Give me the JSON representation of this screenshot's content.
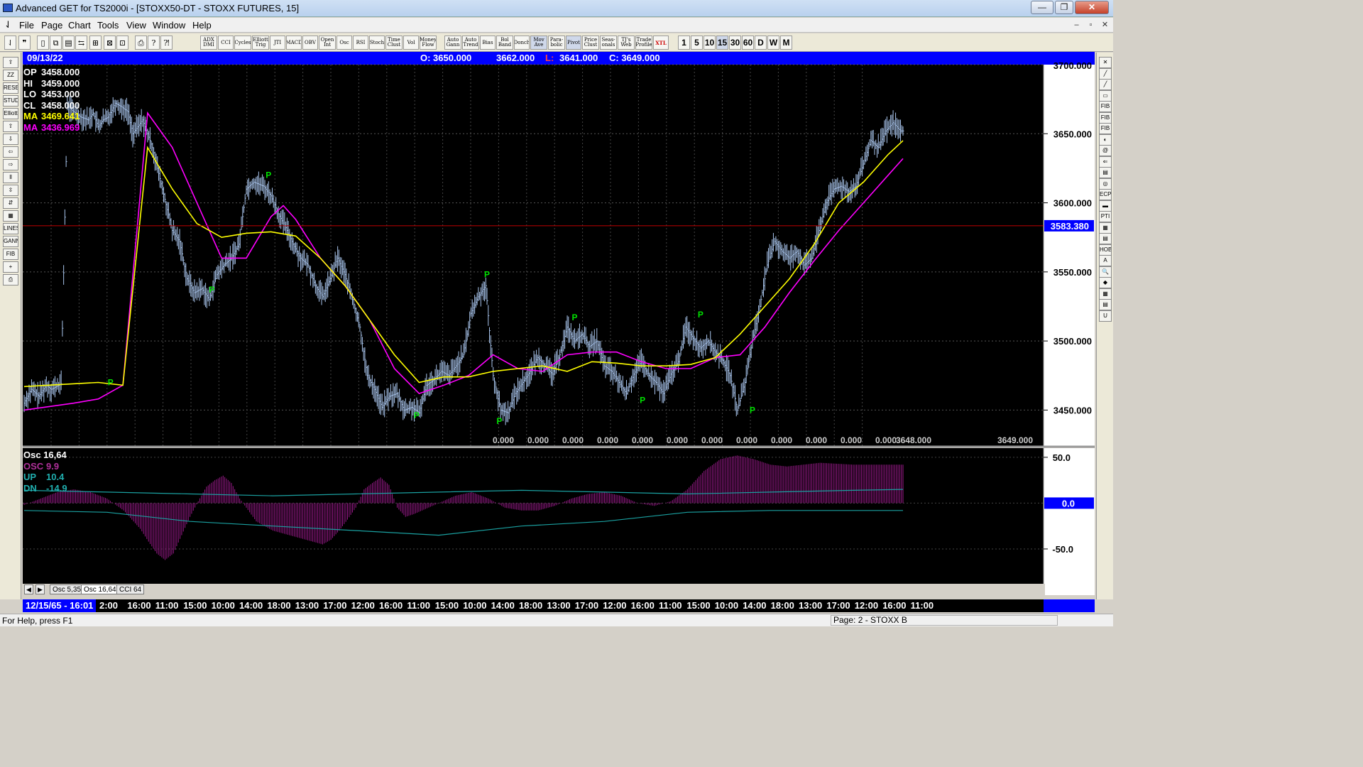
{
  "window": {
    "title": "Advanced GET for TS2000i - [STOXX50-DT - STOXX FUTURES, 15]",
    "buttons": {
      "minimize": "—",
      "maximize": "❐",
      "close": "✕"
    }
  },
  "menu": {
    "items": [
      "File",
      "Page",
      "Chart",
      "Tools",
      "View",
      "Window",
      "Help"
    ],
    "mdi_buttons": [
      "–",
      "▫",
      "✕"
    ]
  },
  "toolbar": {
    "study_buttons": [
      "ADX DMI",
      "CCI",
      "Cycles",
      "Elliott Trig",
      "JTI",
      "MACD",
      "OBV",
      "Open Int",
      "Osc",
      "RSI",
      "Stoch",
      "Time Clust",
      "Vol",
      "Money Flow",
      "Auto Gann",
      "Auto Trend",
      "Bias",
      "Bol Band",
      "Donch",
      "Mov Ave",
      "Para-bolic",
      "Pivot",
      "Price Clust",
      "Seas-onals",
      "TJ's Web",
      "Trade Profile",
      "XTL"
    ],
    "timeframes": [
      "1",
      "5",
      "10",
      "15",
      "30",
      "60",
      "D",
      "W",
      "M"
    ],
    "active_timeframe": "15"
  },
  "left_tools": [
    "⇪",
    "ZZ",
    "RESET",
    "STUDY",
    "Elliott",
    "⇧",
    "⇩",
    "⇦",
    "⇨",
    "⫴",
    "⇳",
    "⇵",
    "▦",
    "LINES",
    "GANN",
    "FIB",
    "+",
    "⎙"
  ],
  "right_tools": [
    "✕",
    "╱",
    "╱",
    "▭",
    "FIB RET",
    "FIB EXT",
    "FIB TIME",
    "◐",
    "@",
    "⇐",
    "▤",
    "◎",
    "ECPS",
    "▬",
    "PTI",
    "▦",
    "▤",
    "HOB",
    "A",
    "🔍",
    "◆",
    "▦",
    "▤",
    "U"
  ],
  "infobar": {
    "date": "09/13/22",
    "open": "O: 3650.000",
    "high": "3662.000",
    "low_label": "L:",
    "low_value": "3641.000",
    "close": "C: 3649.000"
  },
  "legend": [
    {
      "label": "OP",
      "value": "3458.000",
      "color": "#ffffff"
    },
    {
      "label": "HI",
      "value": "3459.000",
      "color": "#ffffff"
    },
    {
      "label": "LO",
      "value": "3453.000",
      "color": "#ffffff"
    },
    {
      "label": "CL",
      "value": "3458.000",
      "color": "#ffffff"
    },
    {
      "label": "MA",
      "value": "3469.641",
      "color": "#ffff00"
    },
    {
      "label": "MA",
      "value": "3436.969",
      "color": "#ff00ff"
    }
  ],
  "price_axis": {
    "ticks": [
      "3700.000",
      "3650.000",
      "3600.000",
      "3550.000",
      "3500.000",
      "3450.000"
    ],
    "marker": "3583.380",
    "bottom_values": [
      "0.000",
      "0.000",
      "0.000",
      "0.000",
      "0.000",
      "0.000",
      "0.000",
      "0.000",
      "0.000",
      "0.000",
      "0.000",
      "0.000",
      "3648.000",
      "3649.000"
    ]
  },
  "oscillator": {
    "title": "Osc 16,64",
    "legend": [
      {
        "label": "OSC",
        "value": "9.9",
        "color": "#b0309a"
      },
      {
        "label": "UP",
        "value": "10.4",
        "color": "#20b0b0"
      },
      {
        "label": "DN",
        "value": "-14.9",
        "color": "#20b0b0"
      }
    ],
    "ticks": [
      "50.0",
      "-50.0"
    ],
    "marker": "0.0",
    "tabs": [
      "Osc 5,35",
      "Osc 16,64",
      "CCI 64"
    ],
    "active_tab": "Osc 16,64",
    "nav": [
      "◀",
      "▶"
    ]
  },
  "time_axis": {
    "start": "12/15/65 - 16:01",
    "labels": [
      "2:00",
      "16:00",
      "11:00",
      "15:00",
      "10:00",
      "14:00",
      "18:00",
      "13:00",
      "17:00",
      "12:00",
      "16:00",
      "11:00",
      "15:00",
      "10:00",
      "14:00",
      "18:00",
      "13:00",
      "17:00",
      "12:00",
      "16:00",
      "11:00",
      "15:00",
      "10:00",
      "14:00",
      "18:00",
      "13:00",
      "17:00",
      "12:00",
      "16:00",
      "11:00"
    ]
  },
  "status": {
    "help": "For Help, press F1",
    "page": "Page: 2 - STOXX B"
  },
  "colors": {
    "chart_bg": "#000000",
    "bar": "#aac6ee",
    "ma_fast": "#ffff00",
    "ma_slow": "#ff00ff",
    "pivot": "#00e000",
    "osc": "#9a1a8a",
    "osc_band": "#1aa0a0",
    "info_blue": "#0000ff",
    "hline": "#c00000"
  },
  "chart_data": {
    "type": "line",
    "title": "STOXX50-DT - STOXX FUTURES, 15",
    "ylim": [
      3425,
      3700
    ],
    "close_path": [
      [
        0,
        3455
      ],
      [
        6,
        3465
      ],
      [
        12,
        3460
      ],
      [
        18,
        3468
      ],
      [
        22,
        3465
      ],
      [
        30,
        3469
      ],
      [
        35,
        3670
      ],
      [
        40,
        3666
      ],
      [
        46,
        3662
      ],
      [
        52,
        3660
      ],
      [
        56,
        3665
      ],
      [
        60,
        3655
      ],
      [
        64,
        3660
      ],
      [
        68,
        3662
      ],
      [
        74,
        3672
      ],
      [
        78,
        3670
      ],
      [
        84,
        3666
      ],
      [
        88,
        3650
      ],
      [
        96,
        3660
      ],
      [
        104,
        3640
      ],
      [
        112,
        3610
      ],
      [
        120,
        3580
      ],
      [
        126,
        3572
      ],
      [
        132,
        3545
      ],
      [
        138,
        3535
      ],
      [
        144,
        3538
      ],
      [
        150,
        3530
      ],
      [
        156,
        3548
      ],
      [
        162,
        3555
      ],
      [
        168,
        3560
      ],
      [
        174,
        3570
      ],
      [
        180,
        3610
      ],
      [
        186,
        3615
      ],
      [
        194,
        3612
      ],
      [
        200,
        3605
      ],
      [
        206,
        3592
      ],
      [
        212,
        3582
      ],
      [
        218,
        3570
      ],
      [
        224,
        3560
      ],
      [
        230,
        3555
      ],
      [
        236,
        3540
      ],
      [
        242,
        3532
      ],
      [
        248,
        3545
      ],
      [
        254,
        3560
      ],
      [
        260,
        3548
      ],
      [
        266,
        3530
      ],
      [
        272,
        3510
      ],
      [
        278,
        3475
      ],
      [
        284,
        3465
      ],
      [
        290,
        3452
      ],
      [
        296,
        3460
      ],
      [
        302,
        3462
      ],
      [
        308,
        3450
      ],
      [
        314,
        3452
      ],
      [
        320,
        3448
      ],
      [
        326,
        3468
      ],
      [
        332,
        3472
      ],
      [
        338,
        3478
      ],
      [
        344,
        3475
      ],
      [
        350,
        3482
      ],
      [
        356,
        3490
      ],
      [
        362,
        3520
      ],
      [
        368,
        3532
      ],
      [
        374,
        3540
      ],
      [
        380,
        3475
      ],
      [
        386,
        3450
      ],
      [
        392,
        3448
      ],
      [
        398,
        3462
      ],
      [
        404,
        3470
      ],
      [
        410,
        3478
      ],
      [
        416,
        3488
      ],
      [
        422,
        3482
      ],
      [
        428,
        3476
      ],
      [
        434,
        3490
      ],
      [
        440,
        3510
      ],
      [
        446,
        3500
      ],
      [
        452,
        3505
      ],
      [
        458,
        3496
      ],
      [
        464,
        3500
      ],
      [
        470,
        3482
      ],
      [
        476,
        3478
      ],
      [
        482,
        3470
      ],
      [
        488,
        3462
      ],
      [
        494,
        3476
      ],
      [
        500,
        3485
      ],
      [
        506,
        3475
      ],
      [
        512,
        3470
      ],
      [
        518,
        3462
      ],
      [
        524,
        3476
      ],
      [
        530,
        3485
      ],
      [
        536,
        3510
      ],
      [
        542,
        3502
      ],
      [
        548,
        3495
      ],
      [
        554,
        3500
      ],
      [
        560,
        3492
      ],
      [
        566,
        3486
      ],
      [
        572,
        3475
      ],
      [
        578,
        3450
      ],
      [
        584,
        3470
      ],
      [
        590,
        3500
      ],
      [
        596,
        3525
      ],
      [
        602,
        3555
      ],
      [
        608,
        3572
      ],
      [
        614,
        3565
      ],
      [
        620,
        3560
      ],
      [
        626,
        3565
      ],
      [
        632,
        3555
      ],
      [
        638,
        3560
      ],
      [
        644,
        3580
      ],
      [
        650,
        3600
      ],
      [
        656,
        3610
      ],
      [
        662,
        3612
      ],
      [
        668,
        3608
      ],
      [
        674,
        3612
      ],
      [
        680,
        3628
      ],
      [
        686,
        3645
      ],
      [
        692,
        3640
      ],
      [
        698,
        3652
      ],
      [
        704,
        3658
      ],
      [
        710,
        3652
      ]
    ],
    "ma_fast": [
      [
        0,
        3467
      ],
      [
        60,
        3470
      ],
      [
        80,
        3468
      ],
      [
        100,
        3640
      ],
      [
        120,
        3610
      ],
      [
        140,
        3585
      ],
      [
        160,
        3575
      ],
      [
        180,
        3578
      ],
      [
        200,
        3579
      ],
      [
        220,
        3576
      ],
      [
        240,
        3560
      ],
      [
        260,
        3540
      ],
      [
        280,
        3515
      ],
      [
        300,
        3490
      ],
      [
        320,
        3470
      ],
      [
        340,
        3474
      ],
      [
        360,
        3474
      ],
      [
        380,
        3478
      ],
      [
        400,
        3480
      ],
      [
        420,
        3482
      ],
      [
        440,
        3478
      ],
      [
        460,
        3485
      ],
      [
        480,
        3484
      ],
      [
        500,
        3482
      ],
      [
        520,
        3482
      ],
      [
        540,
        3483
      ],
      [
        560,
        3488
      ],
      [
        580,
        3505
      ],
      [
        600,
        3525
      ],
      [
        620,
        3545
      ],
      [
        640,
        3570
      ],
      [
        660,
        3600
      ],
      [
        680,
        3615
      ],
      [
        700,
        3635
      ],
      [
        712,
        3645
      ]
    ],
    "ma_slow": [
      [
        0,
        3450
      ],
      [
        40,
        3455
      ],
      [
        60,
        3458
      ],
      [
        80,
        3468
      ],
      [
        100,
        3665
      ],
      [
        120,
        3640
      ],
      [
        140,
        3600
      ],
      [
        160,
        3560
      ],
      [
        180,
        3560
      ],
      [
        200,
        3590
      ],
      [
        210,
        3598
      ],
      [
        220,
        3588
      ],
      [
        240,
        3560
      ],
      [
        260,
        3540
      ],
      [
        280,
        3515
      ],
      [
        300,
        3480
      ],
      [
        320,
        3462
      ],
      [
        340,
        3468
      ],
      [
        360,
        3475
      ],
      [
        380,
        3490
      ],
      [
        400,
        3480
      ],
      [
        420,
        3478
      ],
      [
        440,
        3490
      ],
      [
        460,
        3492
      ],
      [
        480,
        3492
      ],
      [
        500,
        3485
      ],
      [
        520,
        3480
      ],
      [
        540,
        3480
      ],
      [
        560,
        3488
      ],
      [
        580,
        3490
      ],
      [
        600,
        3510
      ],
      [
        620,
        3535
      ],
      [
        640,
        3558
      ],
      [
        660,
        3580
      ],
      [
        680,
        3600
      ],
      [
        700,
        3620
      ],
      [
        712,
        3632
      ]
    ],
    "pivots": [
      {
        "x": 70,
        "y": 3468
      },
      {
        "x": 152,
        "y": 3535
      },
      {
        "x": 198,
        "y": 3618
      },
      {
        "x": 318,
        "y": 3444
      },
      {
        "x": 375,
        "y": 3546
      },
      {
        "x": 385,
        "y": 3440
      },
      {
        "x": 446,
        "y": 3515
      },
      {
        "x": 501,
        "y": 3455
      },
      {
        "x": 548,
        "y": 3517
      },
      {
        "x": 590,
        "y": 3448
      }
    ],
    "osc_values": [
      [
        0,
        -2
      ],
      [
        20,
        5
      ],
      [
        40,
        12
      ],
      [
        60,
        15
      ],
      [
        80,
        12
      ],
      [
        100,
        5
      ],
      [
        120,
        -8
      ],
      [
        140,
        -28
      ],
      [
        150,
        -42
      ],
      [
        160,
        -55
      ],
      [
        170,
        -62
      ],
      [
        180,
        -55
      ],
      [
        190,
        -35
      ],
      [
        200,
        -15
      ],
      [
        210,
        2
      ],
      [
        220,
        18
      ],
      [
        230,
        25
      ],
      [
        240,
        30
      ],
      [
        250,
        22
      ],
      [
        260,
        5
      ],
      [
        280,
        -20
      ],
      [
        300,
        -30
      ],
      [
        320,
        -35
      ],
      [
        340,
        -40
      ],
      [
        360,
        -45
      ],
      [
        370,
        -40
      ],
      [
        380,
        -30
      ],
      [
        390,
        -18
      ],
      [
        400,
        -5
      ],
      [
        410,
        15
      ],
      [
        420,
        22
      ],
      [
        430,
        28
      ],
      [
        440,
        20
      ],
      [
        450,
        -5
      ],
      [
        460,
        -15
      ],
      [
        470,
        -12
      ],
      [
        480,
        -8
      ],
      [
        500,
        0
      ],
      [
        520,
        8
      ],
      [
        540,
        12
      ],
      [
        560,
        5
      ],
      [
        580,
        -5
      ],
      [
        600,
        -8
      ],
      [
        620,
        -8
      ],
      [
        640,
        -3
      ],
      [
        660,
        5
      ],
      [
        680,
        10
      ],
      [
        700,
        12
      ],
      [
        720,
        8
      ],
      [
        740,
        0
      ],
      [
        760,
        -3
      ],
      [
        780,
        2
      ],
      [
        800,
        15
      ],
      [
        820,
        35
      ],
      [
        840,
        48
      ],
      [
        860,
        52
      ],
      [
        880,
        48
      ],
      [
        900,
        42
      ],
      [
        920,
        40
      ],
      [
        940,
        42
      ],
      [
        960,
        44
      ],
      [
        980,
        43
      ],
      [
        1000,
        42
      ],
      [
        1020,
        42
      ],
      [
        1040,
        42
      ],
      [
        1060,
        42
      ]
    ],
    "osc_up": [
      [
        0,
        14
      ],
      [
        100,
        12
      ],
      [
        200,
        10
      ],
      [
        300,
        8
      ],
      [
        400,
        10
      ],
      [
        500,
        12
      ],
      [
        600,
        14
      ],
      [
        700,
        12
      ],
      [
        800,
        10
      ],
      [
        900,
        12
      ],
      [
        1000,
        14
      ],
      [
        1060,
        15
      ]
    ],
    "osc_dn": [
      [
        0,
        -8
      ],
      [
        100,
        -10
      ],
      [
        200,
        -20
      ],
      [
        300,
        -25
      ],
      [
        400,
        -30
      ],
      [
        500,
        -35
      ],
      [
        600,
        -25
      ],
      [
        700,
        -20
      ],
      [
        800,
        -10
      ],
      [
        900,
        -8
      ],
      [
        1000,
        -8
      ],
      [
        1060,
        -8
      ]
    ]
  }
}
